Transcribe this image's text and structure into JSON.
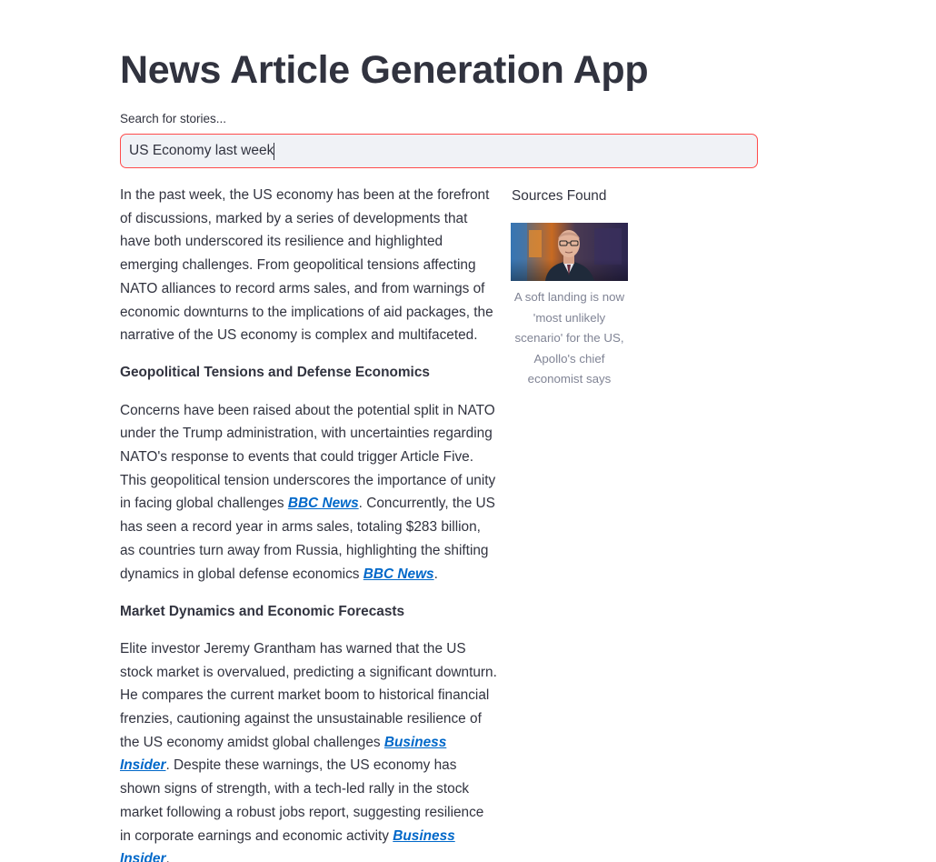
{
  "app": {
    "title": "News Article Generation App"
  },
  "search": {
    "label": "Search for stories...",
    "value": "US Economy last week"
  },
  "article": {
    "intro": "In the past week, the US economy has been at the forefront of discussions, marked by a series of developments that have both underscored its resilience and highlighted emerging challenges. From geopolitical tensions affecting NATO alliances to record arms sales, and from warnings of economic downturns to the implications of aid packages, the narrative of the US economy is complex and multifaceted.",
    "section1": {
      "heading": "Geopolitical Tensions and Defense Economics",
      "text_a": "Concerns have been raised about the potential split in NATO under the Trump administration, with uncertainties regarding NATO's response to events that could trigger Article Five. This geopolitical tension underscores the importance of unity in facing global challenges ",
      "link_a": "BBC News",
      "text_b": ". Concurrently, the US has seen a record year in arms sales, totaling $283 billion, as countries turn away from Russia, highlighting the shifting dynamics in global defense economics ",
      "link_b": "BBC News",
      "text_c": "."
    },
    "section2": {
      "heading": "Market Dynamics and Economic Forecasts",
      "text_a": "Elite investor Jeremy Grantham has warned that the US stock market is overvalued, predicting a significant downturn. He compares the current market boom to historical financial frenzies, cautioning against the unsustainable resilience of the US economy amidst global challenges ",
      "link_a": "Business Insider",
      "text_b": ". Despite these warnings, the US economy has shown signs of strength, with a tech-led rally in the stock market following a robust jobs report, suggesting resilience in corporate earnings and economic activity ",
      "link_b": "Business Insider",
      "text_c": "."
    }
  },
  "sources": {
    "header": "Sources Found",
    "items": [
      {
        "caption": "A soft landing is now 'most unlikely scenario' for the US, Apollo's chief economist says",
        "thumbnail_icon": "news-person-thumbnail"
      }
    ]
  },
  "colors": {
    "accent": "#ff4b4b",
    "link": "#0068c9",
    "text": "#31333f",
    "muted": "#808495",
    "input_bg": "#f0f2f6"
  }
}
